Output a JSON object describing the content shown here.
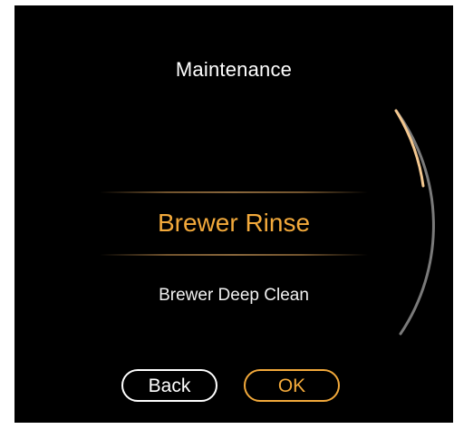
{
  "screen": {
    "title": "Maintenance",
    "selected_item": "Brewer Rinse",
    "next_item": "Brewer Deep Clean"
  },
  "buttons": {
    "back_label": "Back",
    "ok_label": "OK"
  },
  "scroll": {
    "position_fraction": 0.25
  },
  "colors": {
    "background": "#000000",
    "accent": "#f2a93b",
    "text": "#ffffff",
    "track": "#7a7a7a"
  }
}
